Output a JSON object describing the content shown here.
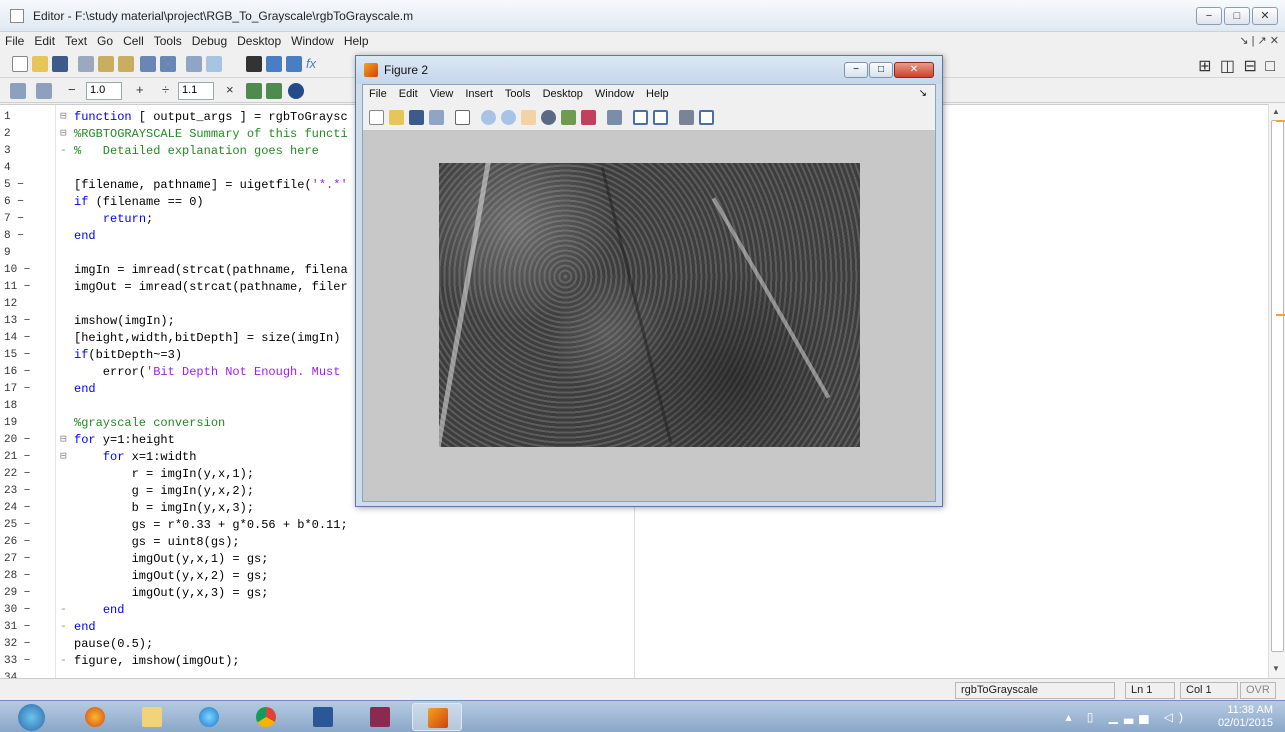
{
  "editor": {
    "title": "Editor - F:\\study material\\project\\RGB_To_Grayscale\\rgbToGrayscale.m",
    "window_controls": [
      "−",
      "□",
      "✕"
    ],
    "menu": [
      "File",
      "Edit",
      "Text",
      "Go",
      "Cell",
      "Tools",
      "Debug",
      "Desktop",
      "Window",
      "Help"
    ],
    "menu_right": "↘ | ↗ ✕",
    "toolbar_fx": "fx",
    "cell_toolbar": {
      "minus": "−",
      "value1": "1.0",
      "plus": "+",
      "divide": "÷",
      "value2": "1.1",
      "times": "×"
    },
    "layout_icons": "⊞ ◫ ⊟ □",
    "lines": [
      {
        "n": "1",
        "fold": "⊟",
        "html": "<span class='kw'>function</span> [ output_args ] = rgbToGraysc"
      },
      {
        "n": "2",
        "fold": "⊟",
        "html": "<span class='cm'>%RGBTOGRAYSCALE Summary of this functi</span>"
      },
      {
        "n": "3",
        "fold": "-",
        "html": "<span class='cm'>%   Detailed explanation goes here</span>"
      },
      {
        "n": "4",
        "fold": "",
        "html": ""
      },
      {
        "n": "5 −",
        "fold": "",
        "html": "[filename, pathname] = uigetfile(<span class='st'>'*.*'</span>"
      },
      {
        "n": "6 −",
        "fold": "",
        "html": "<span class='kw'>if</span> (filename == 0)"
      },
      {
        "n": "7 −",
        "fold": "",
        "html": "    <span class='kw'>return</span>;"
      },
      {
        "n": "8 −",
        "fold": "",
        "html": "<span class='kw'>end</span>"
      },
      {
        "n": "9",
        "fold": "",
        "html": ""
      },
      {
        "n": "10 −",
        "fold": "",
        "html": "imgIn = imread(strcat(pathname, filena"
      },
      {
        "n": "11 −",
        "fold": "",
        "html": "imgOut = imread(strcat(pathname, filer"
      },
      {
        "n": "12",
        "fold": "",
        "html": ""
      },
      {
        "n": "13 −",
        "fold": "",
        "html": "imshow(imgIn);"
      },
      {
        "n": "14 −",
        "fold": "",
        "html": "[height,width,bitDepth] = size(imgIn)"
      },
      {
        "n": "15 −",
        "fold": "",
        "html": "<span class='kw'>if</span>(bitDepth~=3)"
      },
      {
        "n": "16 −",
        "fold": "",
        "html": "    error(<span class='st'>'Bit Depth Not Enough. Must</span>"
      },
      {
        "n": "17 −",
        "fold": "",
        "html": "<span class='kw'>end</span>"
      },
      {
        "n": "18",
        "fold": "",
        "html": ""
      },
      {
        "n": "19",
        "fold": "",
        "html": "<span class='cm'>%grayscale conversion</span>"
      },
      {
        "n": "20 −",
        "fold": "⊟",
        "html": "<span class='kw'>for</span> y=1:height"
      },
      {
        "n": "21 −",
        "fold": "⊟",
        "html": "    <span class='kw'>for</span> x=1:width"
      },
      {
        "n": "22 −",
        "fold": "",
        "html": "        r = imgIn(y,x,1);"
      },
      {
        "n": "23 −",
        "fold": "",
        "html": "        g = imgIn(y,x,2);"
      },
      {
        "n": "24 −",
        "fold": "",
        "html": "        b = imgIn(y,x,3);"
      },
      {
        "n": "25 −",
        "fold": "",
        "html": "        gs = r*0.33 + g*0.56 + b*0.11;"
      },
      {
        "n": "26 −",
        "fold": "",
        "html": "        gs = uint8(gs);"
      },
      {
        "n": "27 −",
        "fold": "",
        "html": "        imgOut(y,x,1) = gs;"
      },
      {
        "n": "28 −",
        "fold": "",
        "html": "        imgOut(y,x,2) = gs;"
      },
      {
        "n": "29 −",
        "fold": "",
        "html": "        imgOut(y,x,3) = gs;"
      },
      {
        "n": "30 −",
        "fold": "-",
        "html": "    <span class='kw'>end</span>"
      },
      {
        "n": "31 −",
        "fold": "-",
        "html": "<span class='kw'>end</span>"
      },
      {
        "n": "32 −",
        "fold": "",
        "html": "pause(0.5);"
      },
      {
        "n": "33 −",
        "fold": "-",
        "html": "figure, imshow(imgOut);"
      },
      {
        "n": "34",
        "fold": "",
        "html": ""
      }
    ],
    "status": {
      "filename": "rgbToGrayscale",
      "ln": "Ln  1",
      "col": "Col  1",
      "ovr": "OVR"
    }
  },
  "figure": {
    "title": "Figure 2",
    "controls": [
      "−",
      "□",
      "✕"
    ],
    "menu": [
      "File",
      "Edit",
      "View",
      "Insert",
      "Tools",
      "Desktop",
      "Window",
      "Help"
    ],
    "menu_right": "↘"
  },
  "taskbar": {
    "time": "11:38 AM",
    "date": "02/01/2015",
    "tray_icons": "▴ ▯ ▁▃▅ ◁)"
  },
  "colors": {
    "keyword": "#0000ff",
    "comment": "#228b22",
    "string": "#a020f0"
  }
}
